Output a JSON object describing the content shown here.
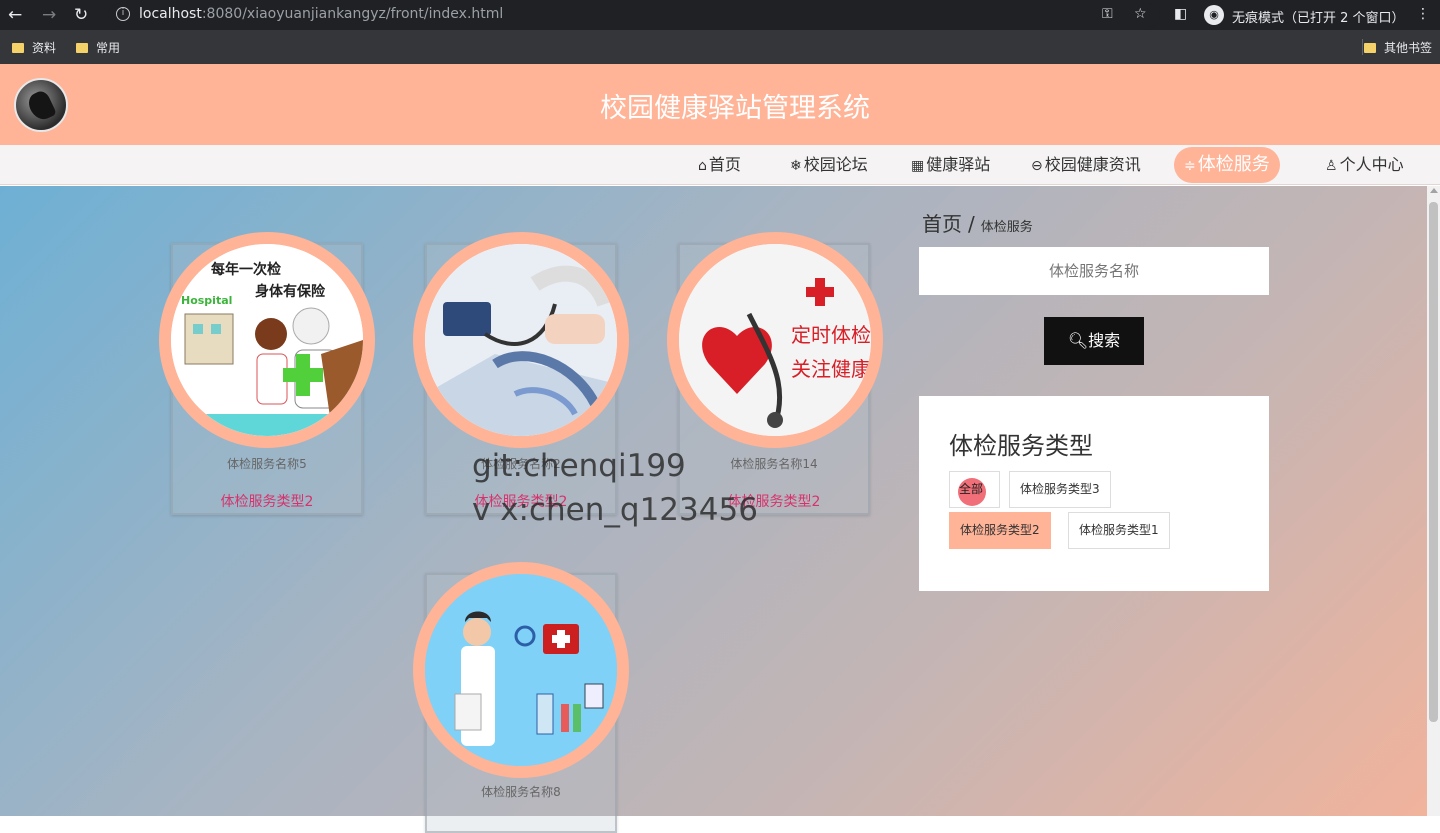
{
  "browser": {
    "url_host": "localhost",
    "url_rest": ":8080/xiaoyuanjiankangyz/front/index.html",
    "incognito_label": "无痕模式（已打开 2 个窗口）",
    "bookmarks": [
      "资料",
      "常用"
    ],
    "other_bookmarks": "其他书签"
  },
  "site": {
    "title": "校园健康驿站管理系统"
  },
  "nav": [
    {
      "icon": "⌂",
      "label": "首页"
    },
    {
      "icon": "❄",
      "label": "校园论坛"
    },
    {
      "icon": "▦",
      "label": "健康驿站"
    },
    {
      "icon": "⊖",
      "label": "校园健康资讯"
    },
    {
      "icon": "≑",
      "label": "体检服务"
    },
    {
      "icon": "♙",
      "label": "个人中心"
    }
  ],
  "breadcrumb": {
    "home": "首页",
    "sep": "/",
    "current": "体检服务"
  },
  "search": {
    "placeholder": "体检服务名称",
    "button": "搜索"
  },
  "types": {
    "title": "体检服务类型",
    "all_label": "全部",
    "tags": [
      "体检服务类型3",
      "体检服务类型2",
      "体检服务类型1"
    ]
  },
  "cards": [
    {
      "name": "体检服务名称5",
      "type": "体检服务类型2",
      "image_text": [
        "每年一次检",
        "身体有保险",
        "Hospital"
      ]
    },
    {
      "name": "体检服务名称2",
      "type": "体检服务类型2"
    },
    {
      "name": "体检服务名称14",
      "type": "体检服务类型2",
      "image_text": [
        "定时体检",
        "关注健康"
      ]
    },
    {
      "name": "体检服务名称8",
      "type": ""
    }
  ],
  "watermark": [
    "git:chenqi199",
    "v x:chen_q123456"
  ],
  "colors": {
    "accent": "#ffb397",
    "type_text": "#d6336c",
    "search_button": "#111111"
  }
}
